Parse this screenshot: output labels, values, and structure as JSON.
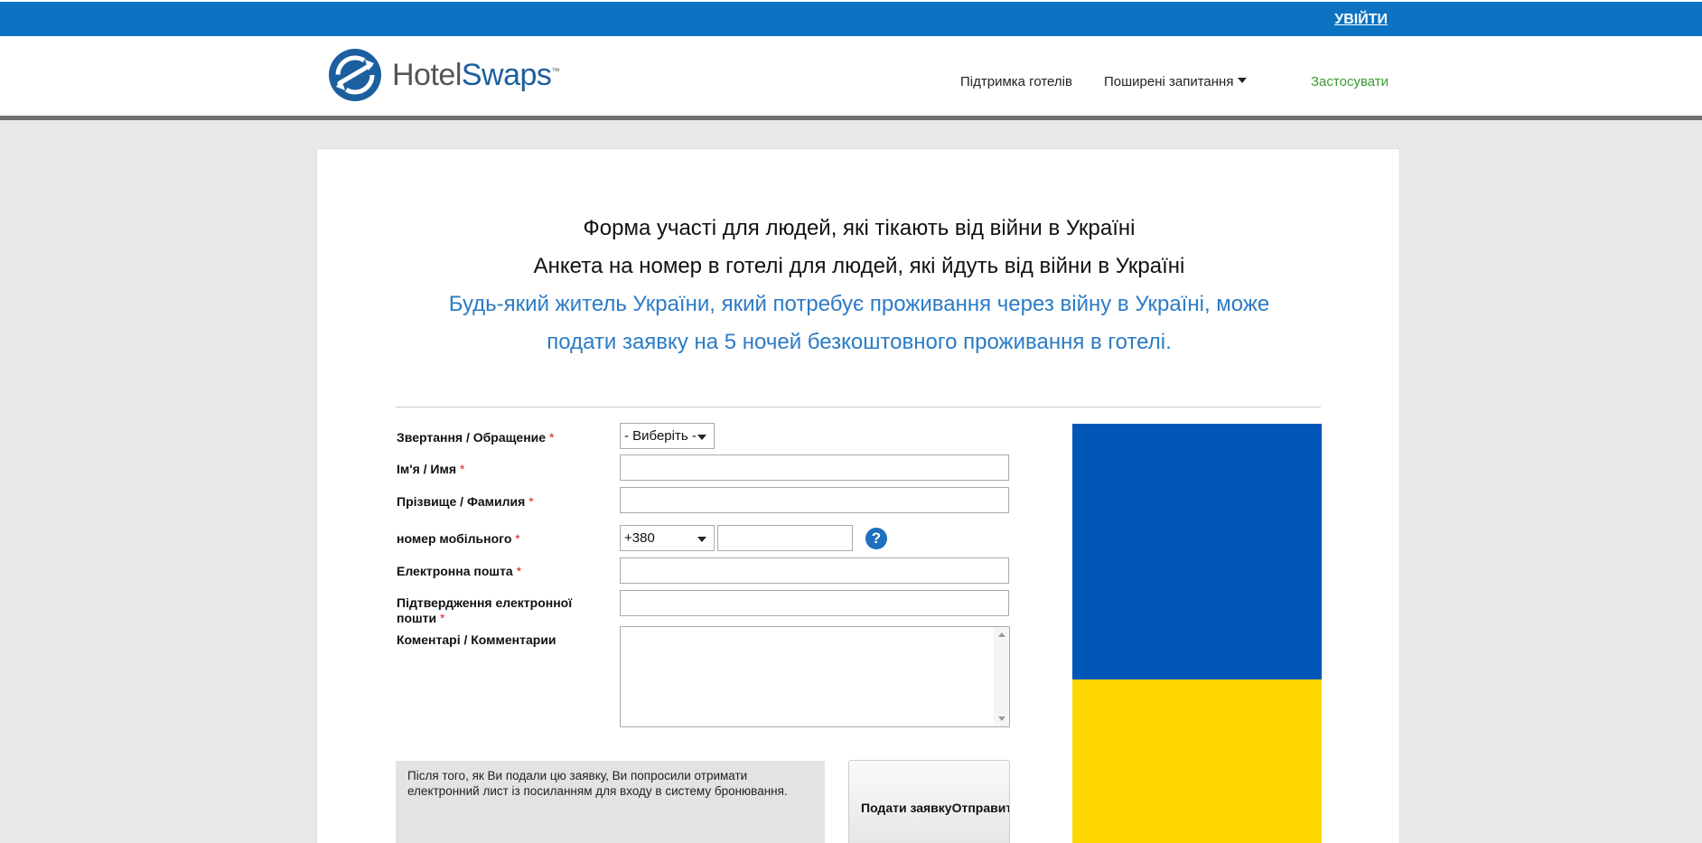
{
  "header": {
    "login_label": "УВІЙТИ",
    "brand_part1": "Hotel",
    "brand_part2": "Swaps",
    "brand_tm": "™",
    "nav": {
      "support": "Підтримка готелів",
      "faq": "Поширені запитання",
      "apply": "Застосувати"
    }
  },
  "form": {
    "title_line1": "Форма участі для людей, які тікають від війни в Україні",
    "title_line2": "Анкета на номер в готелі для людей, які йдуть від війни в Україні",
    "subtitle": "Будь-який житель України, який потребує проживання через війну в Україні, може подати заявку на 5 ночей безкоштовного проживання в готелі.",
    "required_mark": "*",
    "fields": {
      "salutation_label": "Звертання / Обращение",
      "salutation_value": "- Виберіть -",
      "first_name_label": "Ім'я / Имя",
      "last_name_label": "Прізвище / Фамилия",
      "mobile_label": "номер мобільного",
      "mobile_code": "+380",
      "email_label": "Електронна пошта",
      "email_confirm_label": "Підтвердження електронної пошти",
      "comments_label": "Коментарі / Комментарии"
    },
    "notice": "Після того, як Ви подали цю заявку, Ви попросили отримати електронний лист із посиланням для входу в систему бронювання.",
    "submit_label": "Подати заявкуОтправить"
  },
  "colors": {
    "topbar": "#0b73c2",
    "flag_blue": "#0057b7",
    "flag_yellow": "#ffd700",
    "accent_text": "#2b7bc7",
    "apply_link": "#3a9a2f"
  },
  "icons": [
    "hotelswaps-logo-icon",
    "caret-down-icon",
    "help-icon"
  ]
}
